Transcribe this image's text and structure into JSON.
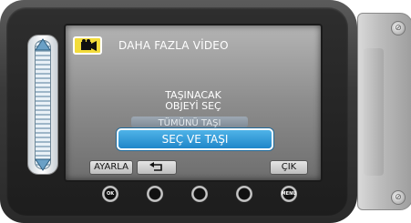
{
  "screen": {
    "title": "DAHA FAZLA VİDEO",
    "mode_icon": "video-mode-icon",
    "prompt_line1": "TAŞINACAK",
    "prompt_line2": "OBJEYİ SEÇ",
    "options": {
      "ghost_above": "TÜMÜNÜ TAŞI",
      "selected": "SEÇ VE TAŞI"
    },
    "softkeys": {
      "left": "AYARLA",
      "back_icon": "return-arrow-icon",
      "right": "ÇIK"
    }
  },
  "hardware_buttons": [
    {
      "label": "OK"
    },
    {
      "label": ""
    },
    {
      "label": ""
    },
    {
      "label": ""
    },
    {
      "label": "MENU"
    }
  ],
  "colors": {
    "selection_blue": "#2a96d6",
    "mode_icon_yellow": "#f3dc3a"
  }
}
